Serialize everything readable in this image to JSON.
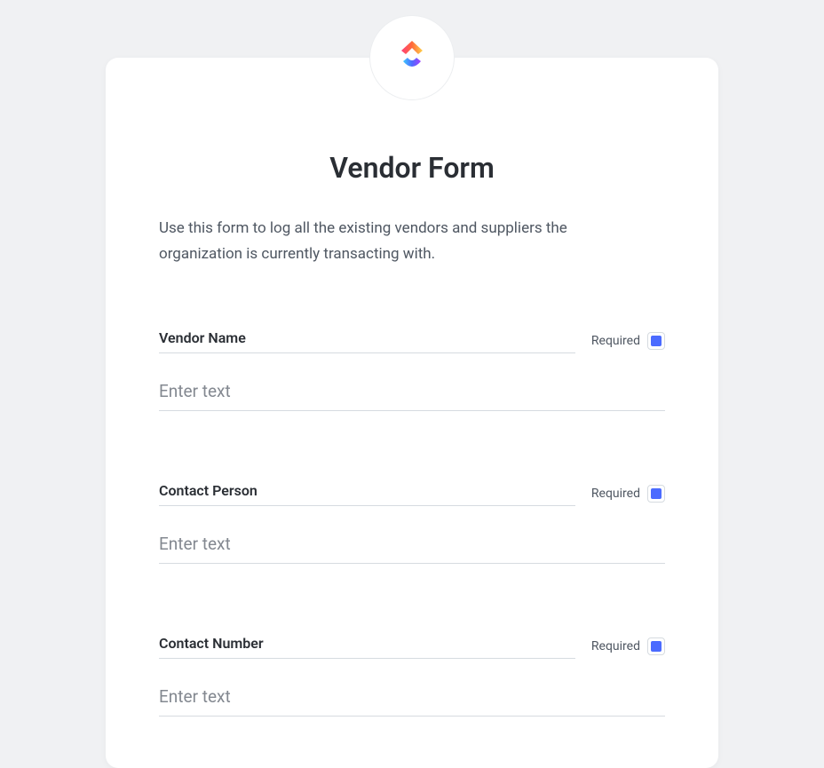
{
  "header": {
    "title": "Vendor Form",
    "description": "Use this form to log all the existing vendors and suppliers the organization is currently transacting with.",
    "logo_name": "clickup-logo"
  },
  "labels": {
    "required": "Required"
  },
  "fields": [
    {
      "label": "Vendor Name",
      "placeholder": "Enter text",
      "required": true
    },
    {
      "label": "Contact Person",
      "placeholder": "Enter text",
      "required": true
    },
    {
      "label": "Contact Number",
      "placeholder": "Enter text",
      "required": true
    }
  ]
}
